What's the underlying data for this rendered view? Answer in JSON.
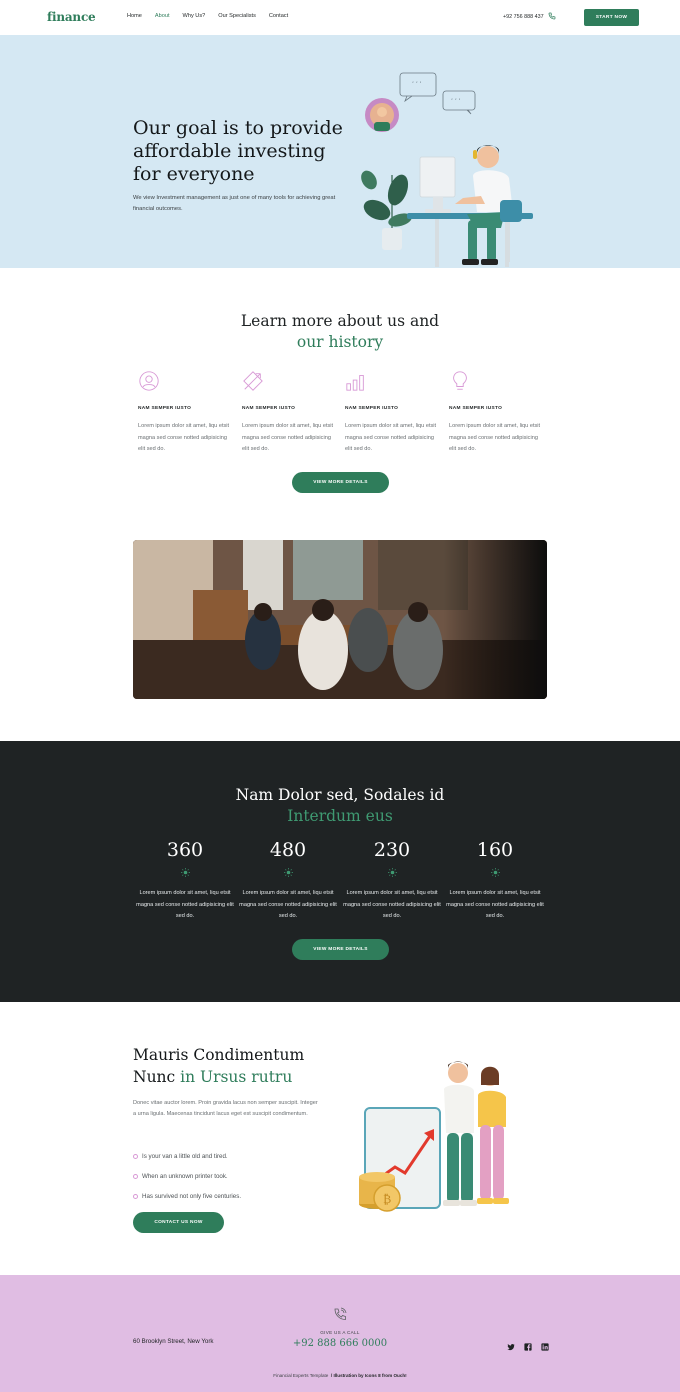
{
  "header": {
    "logo": "finance",
    "nav": [
      "Home",
      "About",
      "Why Us?",
      "Our Specialists",
      "Contact"
    ],
    "active_nav": "About",
    "phone": "+92 756 888 437",
    "cta": "START NOW"
  },
  "hero": {
    "title_line1": "Our goal is to provide",
    "title_line2": "affordable investing",
    "title_line3": "for everyone",
    "text": "We view Investment management as just one of many tools for achieving great financial outcomes."
  },
  "about": {
    "title_part1": "Learn more about us and",
    "title_part2": "our history",
    "features": [
      {
        "icon": "user-circle-icon",
        "title": "NAM SEMPER IUSTO",
        "text": "Lorem ipsum dolor sit amet, liqu etsit magna sed conse notted adipisicing elit sed do."
      },
      {
        "icon": "compass-arrow-icon",
        "title": "NAM SEMPER IUSTO",
        "text": "Lorem ipsum dolor sit amet, liqu etsit magna sed conse notted adipisicing elit sed do."
      },
      {
        "icon": "bar-chart-icon",
        "title": "NAM SEMPER IUSTO",
        "text": "Lorem ipsum dolor sit amet, liqu etsit magna sed conse notted adipisicing elit sed do."
      },
      {
        "icon": "lightbulb-icon",
        "title": "NAM SEMPER IUSTO",
        "text": "Lorem ipsum dolor sit amet, liqu etsit magna sed conse notted adipisicing elit sed do."
      }
    ],
    "button": "VIEW MORE DETAILS"
  },
  "stats": {
    "title_part1": "Nam Dolor sed, Sodales id",
    "title_part2": "Interdum eus",
    "items": [
      {
        "number": "360",
        "text": "Lorem ipsum dolor sit amet, liqu etsit magna sed conse notted adipisicing elit sed do."
      },
      {
        "number": "480",
        "text": "Lorem ipsum dolor sit amet, liqu etsit magna sed conse notted adipisicing elit sed do."
      },
      {
        "number": "230",
        "text": "Lorem ipsum dolor sit amet, liqu etsit magna sed conse notted adipisicing elit sed do."
      },
      {
        "number": "160",
        "text": "Lorem ipsum dolor sit amet, liqu etsit magna sed conse notted adipisicing elit sed do."
      }
    ],
    "button": "VIEW MORE DETAILS"
  },
  "mauris": {
    "title_line1": "Mauris Condimentum",
    "title_line2_a": "Nunc ",
    "title_line2_b": "in Ursus rutru",
    "text": "Donec vitae auctor lorem. Proin gravida lacus non semper suscipit. Integer a urna ligula. Maecenas tincidunt lacus eget est suscipit condimentum.",
    "list": [
      "Is your van a little old and tired.",
      "When an unknown printer took.",
      "Has survived not only five centuries."
    ],
    "button": "CONTACT US NOW"
  },
  "footer": {
    "address": "60 Brooklyn Street, New York",
    "give_call": "GIVE US A CALL",
    "phone": "+92 888 666 0000",
    "social": [
      "twitter-icon",
      "facebook-icon",
      "linkedin-icon"
    ],
    "credit_a": "Financial Experts Template",
    "credit_b": "/ Illustration by Icons 8 from Ouch!"
  },
  "colors": {
    "accent": "#2f7d5b",
    "hero_bg": "#d5e8f3",
    "dark_bg": "#1f2324",
    "footer_bg": "#e0bde3",
    "icon_pink": "#d89ad6"
  }
}
